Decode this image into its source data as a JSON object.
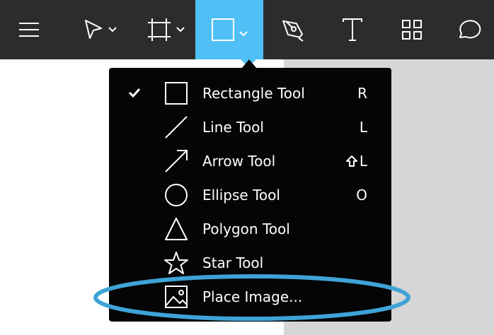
{
  "colors": {
    "toolbar_bg": "#2c2c2c",
    "active_tool_bg": "#4fbff6",
    "menu_bg": "#050505",
    "canvas_white": "#ffffff",
    "canvas_gray": "#d6d6d6",
    "highlight_stroke": "#3fa3d8"
  },
  "toolbar": {
    "tools": [
      {
        "name": "menu",
        "icon": "hamburger-icon"
      },
      {
        "name": "move",
        "icon": "arrow-cursor-icon",
        "dropdown": true
      },
      {
        "name": "frame",
        "icon": "frame-icon",
        "dropdown": true
      },
      {
        "name": "shape",
        "icon": "rectangle-icon",
        "dropdown": true,
        "active": true
      },
      {
        "name": "pen",
        "icon": "pen-icon"
      },
      {
        "name": "text",
        "icon": "text-icon"
      },
      {
        "name": "components",
        "icon": "grid-icon"
      },
      {
        "name": "comment",
        "icon": "comment-icon"
      }
    ]
  },
  "menu": {
    "items": [
      {
        "label": "Rectangle Tool",
        "shortcut": "R",
        "checked": true,
        "icon": "rectangle-icon"
      },
      {
        "label": "Line Tool",
        "shortcut": "L",
        "checked": false,
        "icon": "line-icon"
      },
      {
        "label": "Arrow Tool",
        "shortcut": "L",
        "shortcut_modifier": "shift",
        "checked": false,
        "icon": "arrow-icon"
      },
      {
        "label": "Ellipse Tool",
        "shortcut": "O",
        "checked": false,
        "icon": "ellipse-icon"
      },
      {
        "label": "Polygon Tool",
        "shortcut": "",
        "checked": false,
        "icon": "triangle-icon"
      },
      {
        "label": "Star Tool",
        "shortcut": "",
        "checked": false,
        "icon": "star-icon"
      },
      {
        "label": "Place Image...",
        "shortcut": "",
        "checked": false,
        "icon": "image-icon",
        "highlighted": true
      }
    ]
  }
}
